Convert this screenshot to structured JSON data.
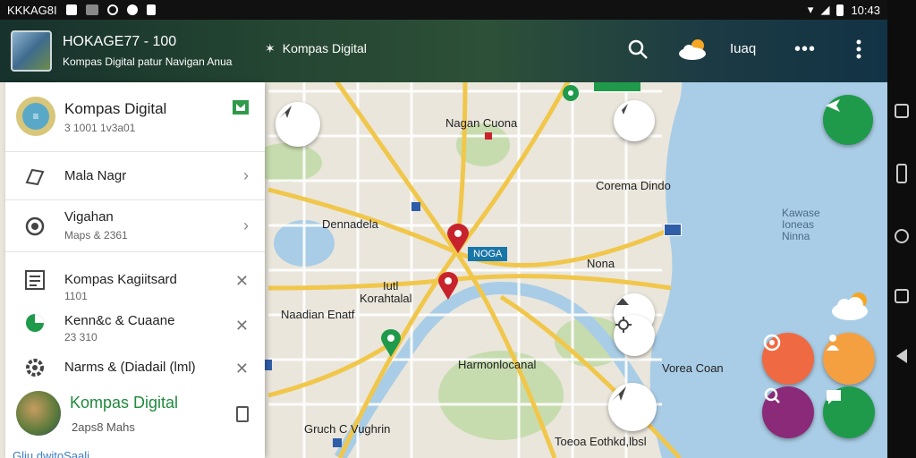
{
  "status_bar": {
    "left_text": "KKKAG8I",
    "time": "10:43"
  },
  "top_bar": {
    "title": "HOKAGE77 - 100",
    "subtitle": "Kompas Digital patur Navigan Anua",
    "brand": "Kompas Digital",
    "user_label": "Iuaq",
    "more_dots": "•••"
  },
  "panel": {
    "account": {
      "name": "Kompas Digital",
      "id": "3 1001 1v3a01"
    },
    "items": [
      {
        "title": "Mala Nagr",
        "subtitle": "",
        "trailing": "›",
        "icon": "layers-icon"
      },
      {
        "title": "Vigahan",
        "subtitle": "Maps & 2361",
        "trailing": "›",
        "icon": "target-icon"
      },
      {
        "title": "Kompas Kagiitsard",
        "subtitle": "1101",
        "trailing": "✕",
        "icon": "list-icon"
      },
      {
        "title": "Kenn&c & Cuaane",
        "subtitle": "23 310",
        "trailing": "✕",
        "icon": "pie-icon"
      },
      {
        "title": "Narms & (Diadail (lml)",
        "subtitle": "",
        "trailing": "✕",
        "icon": "gear-icon"
      }
    ],
    "bottom": {
      "title": "Kompas Digital",
      "subtitle": "2aps8 Mahs",
      "link": "Gliu dwitoSaali"
    }
  },
  "map_labels": [
    {
      "key": "nagan",
      "text": "Nagan Cuona"
    },
    {
      "key": "corema",
      "text": "Corema Dindo"
    },
    {
      "key": "dennad",
      "text": "Dennadela"
    },
    {
      "key": "nona",
      "text": "Nona"
    },
    {
      "key": "iutl",
      "text": "Iutl"
    },
    {
      "key": "korah",
      "text": "Korahtalal"
    },
    {
      "key": "naadian",
      "text": "Naadian Enatf"
    },
    {
      "key": "harmon",
      "text": "Harmonlocanal"
    },
    {
      "key": "vorea",
      "text": "Vorea Coan"
    },
    {
      "key": "gruch",
      "text": "Gruch C Vughrin"
    },
    {
      "key": "bottom",
      "text": "Toeoa Eothkd,lbsl"
    },
    {
      "key": "water",
      "text": "Kawase Ioneas Ninna"
    }
  ],
  "map_callout": "NOGA",
  "colors": {
    "accent_green": "#1f9a4b",
    "orange_red": "#ef6a43",
    "orange": "#f5a040",
    "purple": "#8a2a78",
    "water": "#a9cde6",
    "park": "#c7dcae",
    "road": "#f1c74b"
  }
}
